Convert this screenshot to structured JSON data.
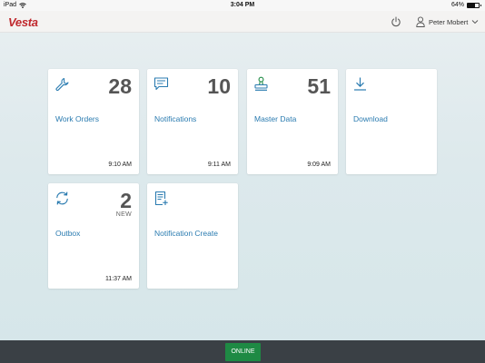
{
  "status_bar": {
    "device": "iPad",
    "time": "3:04 PM",
    "battery": "64%",
    "battery_level": 0.64
  },
  "header": {
    "logo_text": "Vesta",
    "user_name": "Peter Mobert"
  },
  "tiles": [
    {
      "title": "Work Orders",
      "count": "28",
      "subtitle": "",
      "time": "9:10 AM",
      "icon": "wrench-icon"
    },
    {
      "title": "Notifications",
      "count": "10",
      "subtitle": "",
      "time": "9:11 AM",
      "icon": "message-icon"
    },
    {
      "title": "Master Data",
      "count": "51",
      "subtitle": "",
      "time": "9:09 AM",
      "icon": "stamp-icon"
    },
    {
      "title": "Download",
      "count": "",
      "subtitle": "",
      "time": "",
      "icon": "download-icon"
    },
    {
      "title": "Outbox",
      "count": "2",
      "subtitle": "NEW",
      "time": "11:37 AM",
      "icon": "sync-icon"
    },
    {
      "title": "Notification Create",
      "count": "",
      "subtitle": "",
      "time": "",
      "icon": "document-add-icon"
    }
  ],
  "footer": {
    "status_label": "ONLINE"
  },
  "colors": {
    "brand": "#c0282d",
    "accent": "#2a7bb0",
    "online": "#1e8a44",
    "footer": "#3a4045"
  }
}
